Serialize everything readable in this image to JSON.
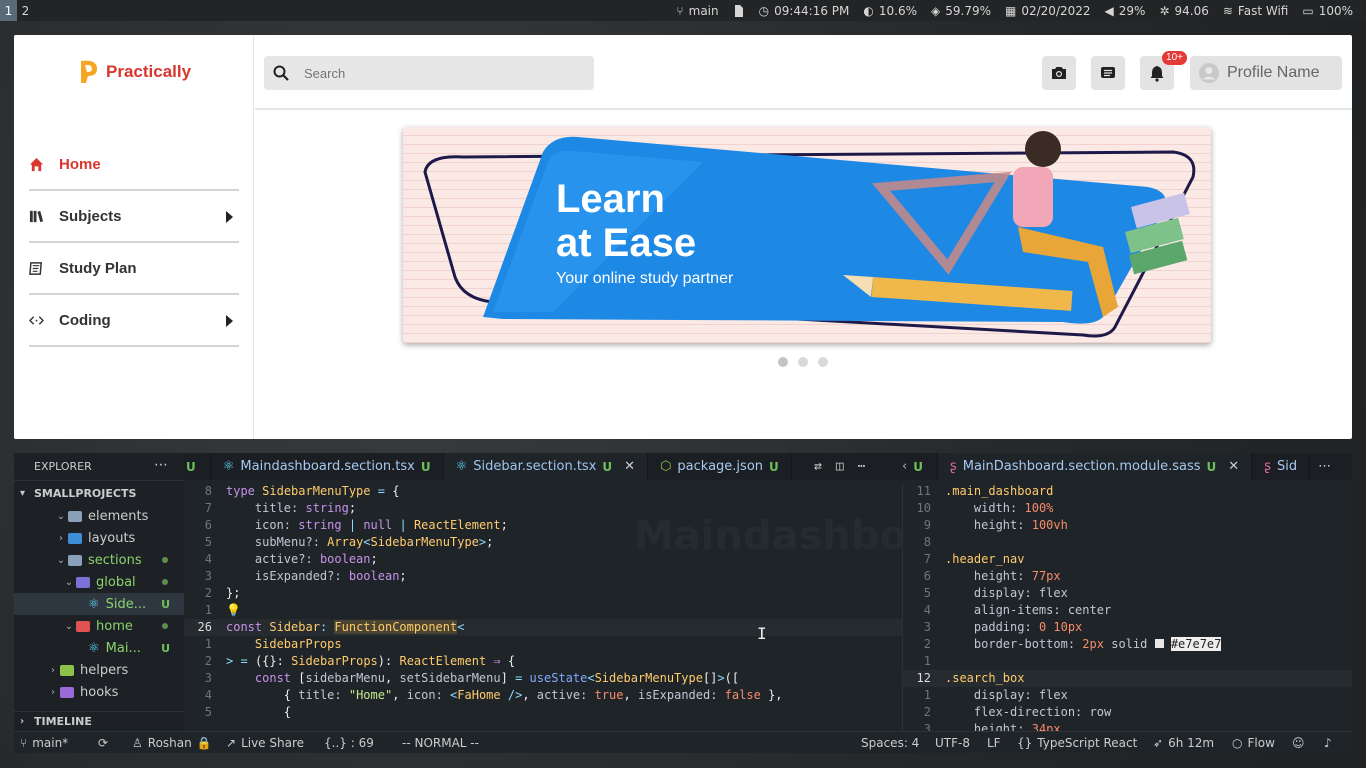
{
  "topbar": {
    "workspaces": [
      "1",
      "2"
    ],
    "branch": "main",
    "time": "09:44:16 PM",
    "cpu": "10.6%",
    "memory": "59.79%",
    "date": "02/20/2022",
    "volume": "29%",
    "temp": "94.06",
    "wifi": "Fast Wifi",
    "battery": "100%"
  },
  "app": {
    "logo_text": "Practically",
    "nav": [
      {
        "label": "Home",
        "icon": "home-icon",
        "active": true
      },
      {
        "label": "Subjects",
        "icon": "books-icon",
        "has_submenu": true
      },
      {
        "label": "Study Plan",
        "icon": "plan-icon"
      },
      {
        "label": "Coding",
        "icon": "code-icon",
        "has_submenu": true
      }
    ],
    "search_placeholder": "Search",
    "notification_badge": "10+",
    "profile_name": "Profile Name",
    "banner": {
      "title_line1": "Learn",
      "title_line2": "at Ease",
      "subtitle": "Your online study partner"
    },
    "carousel_dots": 3,
    "colors": {
      "brand": "#d9362e",
      "accent": "#1e88e5",
      "logo_yellow": "#f5a623"
    }
  },
  "editor": {
    "explorer_title": "EXPLORER",
    "project": "SMALLPROJECTS",
    "tree": [
      {
        "label": "elements",
        "state": "expanded",
        "type": "folder"
      },
      {
        "label": "layouts",
        "state": "collapsed",
        "type": "folder"
      },
      {
        "label": "sections",
        "state": "expanded",
        "type": "folder",
        "modified": true
      },
      {
        "label": "global",
        "state": "expanded",
        "type": "folder",
        "modified": true
      },
      {
        "label": "Side...",
        "type": "file",
        "badge": "U",
        "selected": true
      },
      {
        "label": "home",
        "state": "expanded",
        "type": "folder",
        "modified": true
      },
      {
        "label": "Mai...",
        "type": "file",
        "badge": "U"
      },
      {
        "label": "helpers",
        "state": "collapsed",
        "type": "folder"
      },
      {
        "label": "hooks",
        "state": "collapsed",
        "type": "folder"
      }
    ],
    "timeline": "TIMELINE",
    "tabs_left": [
      {
        "label": "U",
        "partial": true
      },
      {
        "label": "Maindashboard.section.tsx",
        "badge": "U"
      },
      {
        "label": "Sidebar.section.tsx",
        "badge": "U",
        "active": true
      },
      {
        "label": "package.json",
        "badge": "U"
      }
    ],
    "tabs_right": [
      {
        "label": "U",
        "partial": true
      },
      {
        "label": "MainDashboard.section.module.sass",
        "badge": "U",
        "active": true
      },
      {
        "label": "Sid",
        "partial": true
      }
    ],
    "left_code_watermark": "Maindashboard",
    "left_line_numbers": [
      "8",
      "7",
      "6",
      "5",
      "4",
      "3",
      "2",
      "1",
      "26",
      "1",
      "2",
      "3",
      "4",
      "5"
    ],
    "right_line_numbers": [
      "11",
      "10",
      "9",
      "8",
      "7",
      "6",
      "5",
      "4",
      "3",
      "2",
      "1",
      "12",
      "1",
      "2",
      "3"
    ],
    "status": {
      "branch": "main*",
      "user": "Roshan",
      "live_share": "Live Share",
      "position": "{..} : 69",
      "mode": "-- NORMAL --",
      "spaces": "Spaces: 4",
      "encoding": "UTF-8",
      "eol": "LF",
      "language": "TypeScript React",
      "time_tracked": "6h 12m",
      "flow": "Flow"
    }
  }
}
